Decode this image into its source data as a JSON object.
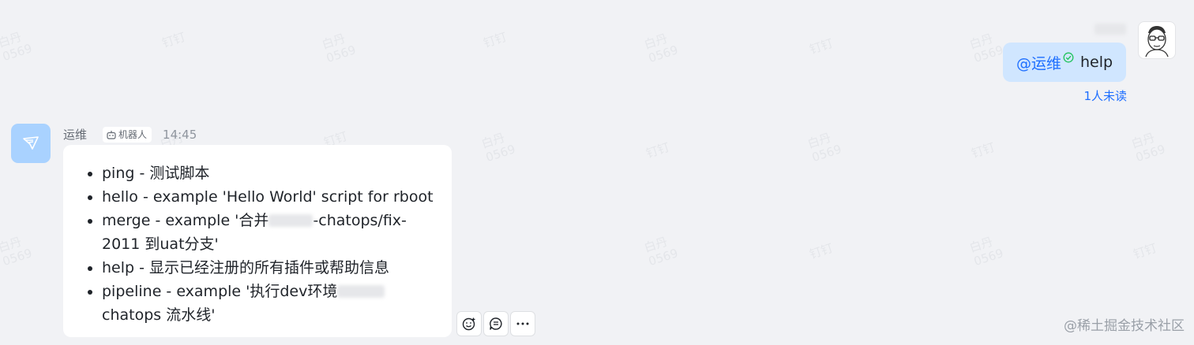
{
  "watermark": {
    "line1": "白丹",
    "line2": "0569",
    "line3": "钉钉"
  },
  "outgoing": {
    "mention": "@运维",
    "text": "help",
    "unread": "1人未读"
  },
  "incoming": {
    "sender": "运维",
    "bot_tag": "机器人",
    "time": "14:45",
    "items": [
      {
        "part1": "ping - 测试脚本",
        "part2": ""
      },
      {
        "part1": "hello - example 'Hello World' script for rboot",
        "part2": ""
      },
      {
        "part1": "merge - example '合并",
        "part2": "-chatops/fix-2011 到uat分支'"
      },
      {
        "part1": "help - 显示已经注册的所有插件或帮助信息",
        "part2": ""
      },
      {
        "part1": "pipeline - example '执行dev环境",
        "part2": "chatops 流水线'"
      }
    ]
  },
  "actions": {
    "icons": [
      "emoji-reaction-icon",
      "reply-icon",
      "more-icon"
    ]
  },
  "footer": "@稀土掘金技术社区",
  "colors": {
    "background": "#f1f2f5",
    "outgoing_bubble": "#d0e6ff",
    "accent": "#1e6fff",
    "bot_avatar": "#a9d2ff"
  }
}
